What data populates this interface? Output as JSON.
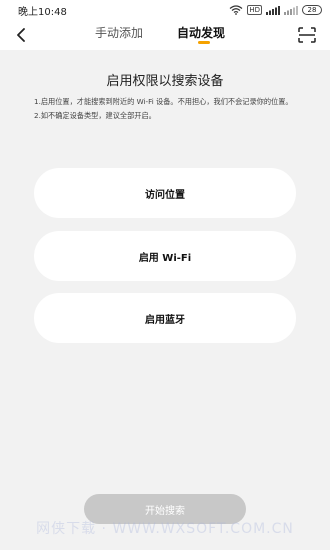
{
  "status_bar": {
    "time": "晚上10:48",
    "hd_label": "HD",
    "battery": "28",
    "icons": [
      "wifi-icon",
      "hd-icon",
      "signal-icon",
      "signal-icon",
      "battery-icon"
    ]
  },
  "nav": {
    "back_icon": "chevron-left-icon",
    "tabs": [
      {
        "label": "手动添加",
        "active": false
      },
      {
        "label": "自动发现",
        "active": true
      }
    ],
    "scan_icon": "scan-icon",
    "accent_color": "#f5a200"
  },
  "main": {
    "heading": "启用权限以搜索设备",
    "desc_1": "1.启用位置，才能搜索到附近的 Wi-Fi 设备。不用担心，我们不会记录你的位置。",
    "desc_2": "2.如不确定设备类型，建议全部开启。",
    "permissions": [
      {
        "label": "访问位置"
      },
      {
        "label": "启用 Wi-Fi"
      },
      {
        "label": "启用蓝牙"
      }
    ],
    "start_button": "开始搜索"
  },
  "watermark": "网侠下载 · WWW.WXSOFT.COM.CN"
}
